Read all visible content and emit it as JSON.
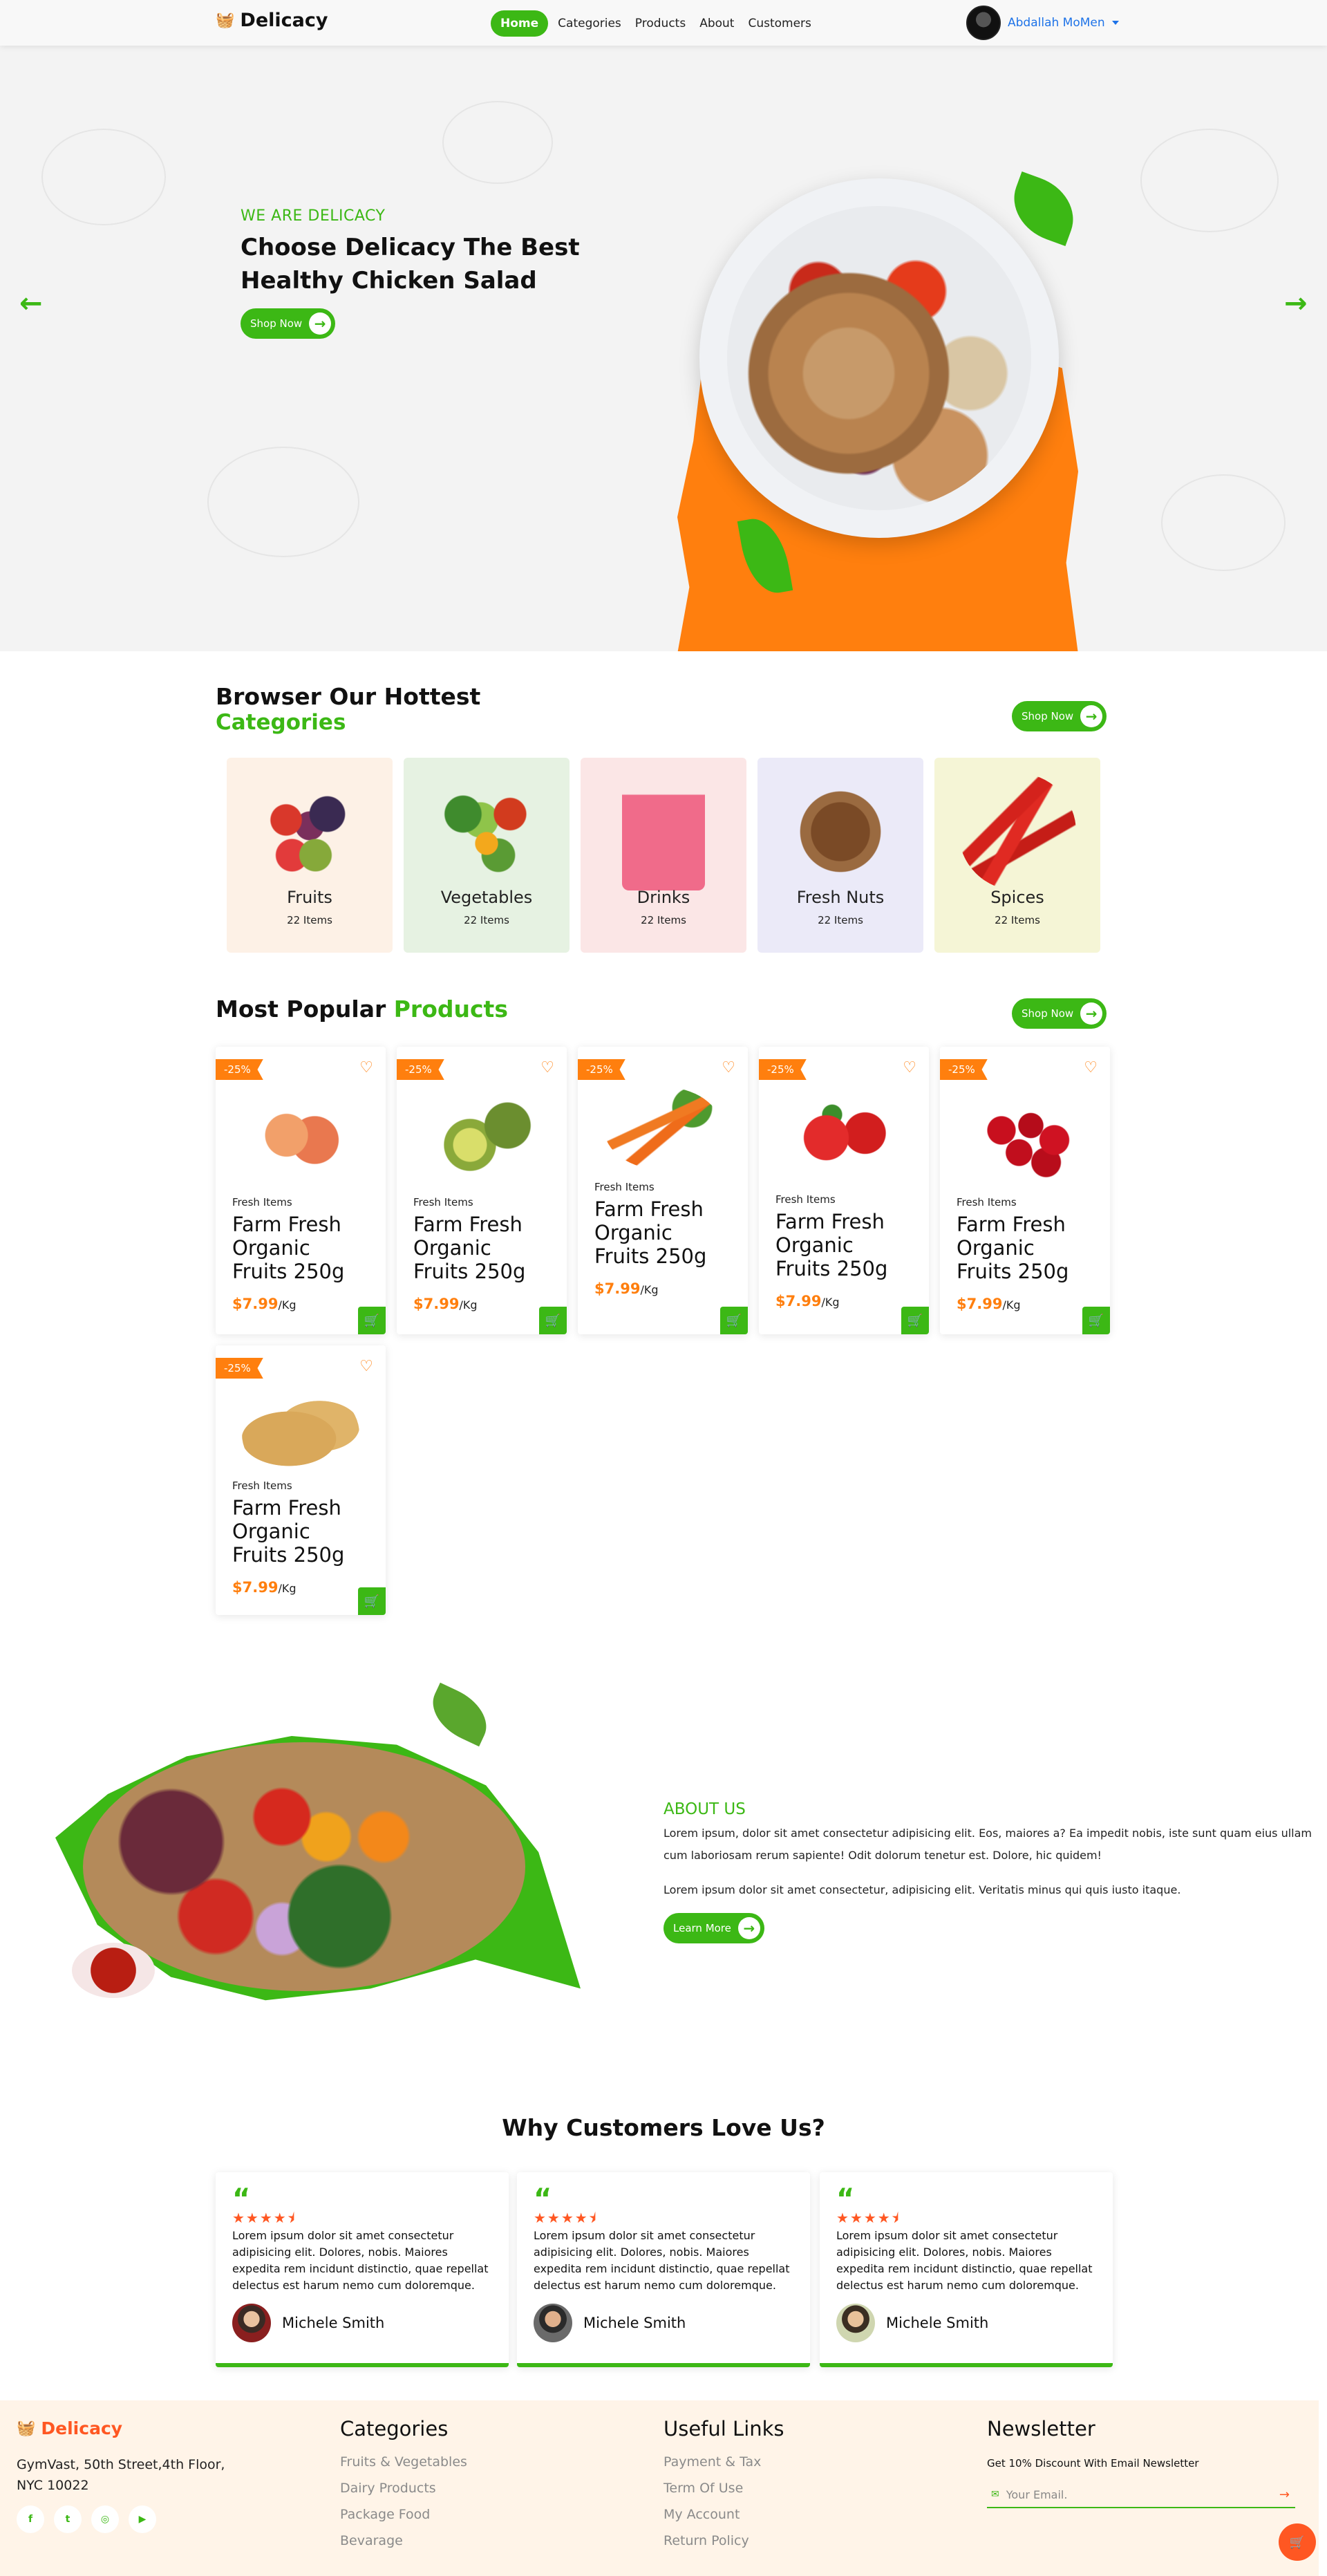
{
  "navbar": {
    "brand": "Delicacy",
    "links": [
      "Home",
      "Categories",
      "Products",
      "About",
      "Customers"
    ],
    "user_name": "Abdallah MoMen"
  },
  "hero": {
    "eyebrow": "WE ARE DELICACY",
    "title": "Choose Delicacy The Best Healthy Chicken Salad",
    "button": "Shop Now"
  },
  "categories": {
    "title_part1": "Browser Our Hottest",
    "title_part2": "Categories",
    "button": "Shop Now",
    "items": [
      {
        "name": "Fruits",
        "count": "22 Items",
        "bg": "#fdf1e6"
      },
      {
        "name": "Vegetables",
        "count": "22 Items",
        "bg": "#e6f2e2"
      },
      {
        "name": "Drinks",
        "count": "22 Items",
        "bg": "#fbe6e6"
      },
      {
        "name": "Fresh Nuts",
        "count": "22 Items",
        "bg": "#ebeaf8"
      },
      {
        "name": "Spices",
        "count": "22 Items",
        "bg": "#f5f5d6"
      }
    ]
  },
  "products": {
    "title_part1": "Most Popular",
    "title_part2": "Products",
    "button": "Shop Now",
    "items": [
      {
        "badge": "-25%",
        "category": "Fresh Items",
        "title": "Farm Fresh Organic Fruits 250g",
        "price": "$7.99",
        "unit": "/Kg"
      },
      {
        "badge": "-25%",
        "category": "Fresh Items",
        "title": "Farm Fresh Organic Fruits 250g",
        "price": "$7.99",
        "unit": "/Kg"
      },
      {
        "badge": "-25%",
        "category": "Fresh Items",
        "title": "Farm Fresh Organic Fruits 250g",
        "price": "$7.99",
        "unit": "/Kg"
      },
      {
        "badge": "-25%",
        "category": "Fresh Items",
        "title": "Farm Fresh Organic Fruits 250g",
        "price": "$7.99",
        "unit": "/Kg"
      },
      {
        "badge": "-25%",
        "category": "Fresh Items",
        "title": "Farm Fresh Organic Fruits 250g",
        "price": "$7.99",
        "unit": "/Kg"
      },
      {
        "badge": "-25%",
        "category": "Fresh Items",
        "title": "Farm Fresh Organic Fruits 250g",
        "price": "$7.99",
        "unit": "/Kg"
      }
    ]
  },
  "about": {
    "eyebrow": "ABOUT US",
    "paragraph1": "Lorem ipsum, dolor sit amet consectetur adipisicing elit. Eos, maiores a? Ea impedit nobis, iste sunt quam eius ullam cum laboriosam rerum sapiente! Odit dolorum tenetur est. Dolore, hic quidem!",
    "paragraph2": "Lorem ipsum dolor sit amet consectetur, adipisicing elit. Veritatis minus qui quis iusto itaque.",
    "button": "Learn More"
  },
  "testimonials": {
    "title": "Why Customers Love Us?",
    "items": [
      {
        "text": "Lorem ipsum dolor sit amet consectetur adipisicing elit. Dolores, nobis. Maiores expedita rem incidunt distinctio, quae repellat delectus est harum nemo cum doloremque.",
        "name": "Michele Smith",
        "rating": 4.5
      },
      {
        "text": "Lorem ipsum dolor sit amet consectetur adipisicing elit. Dolores, nobis. Maiores expedita rem incidunt distinctio, quae repellat delectus est harum nemo cum doloremque.",
        "name": "Michele Smith",
        "rating": 4.5
      },
      {
        "text": "Lorem ipsum dolor sit amet consectetur adipisicing elit. Dolores, nobis. Maiores expedita rem incidunt distinctio, quae repellat delectus est harum nemo cum doloremque.",
        "name": "Michele Smith",
        "rating": 4.5
      }
    ]
  },
  "footer": {
    "brand": "Delicacy",
    "address": "GymVast, 50th Street,4th Floor, NYC 10022",
    "social_icons": [
      "facebook-icon",
      "twitter-icon",
      "instagram-icon",
      "youtube-icon"
    ],
    "categories_title": "Categories",
    "categories": [
      "Fruits & Vegetables",
      "Dairy Products",
      "Package Food",
      "Bevarage"
    ],
    "links_title": "Useful Links",
    "links": [
      "Payment & Tax",
      "Term Of Use",
      "My Account",
      "Return Policy"
    ],
    "newsletter_title": "Newsletter",
    "newsletter_sub": "Get 10% Discount With Email Newsletter",
    "newsletter_placeholder": "Your Email."
  },
  "colors": {
    "brand_green": "#3cb815",
    "brand_orange": "#ff7f0e",
    "accent_red": "#ff5722"
  }
}
